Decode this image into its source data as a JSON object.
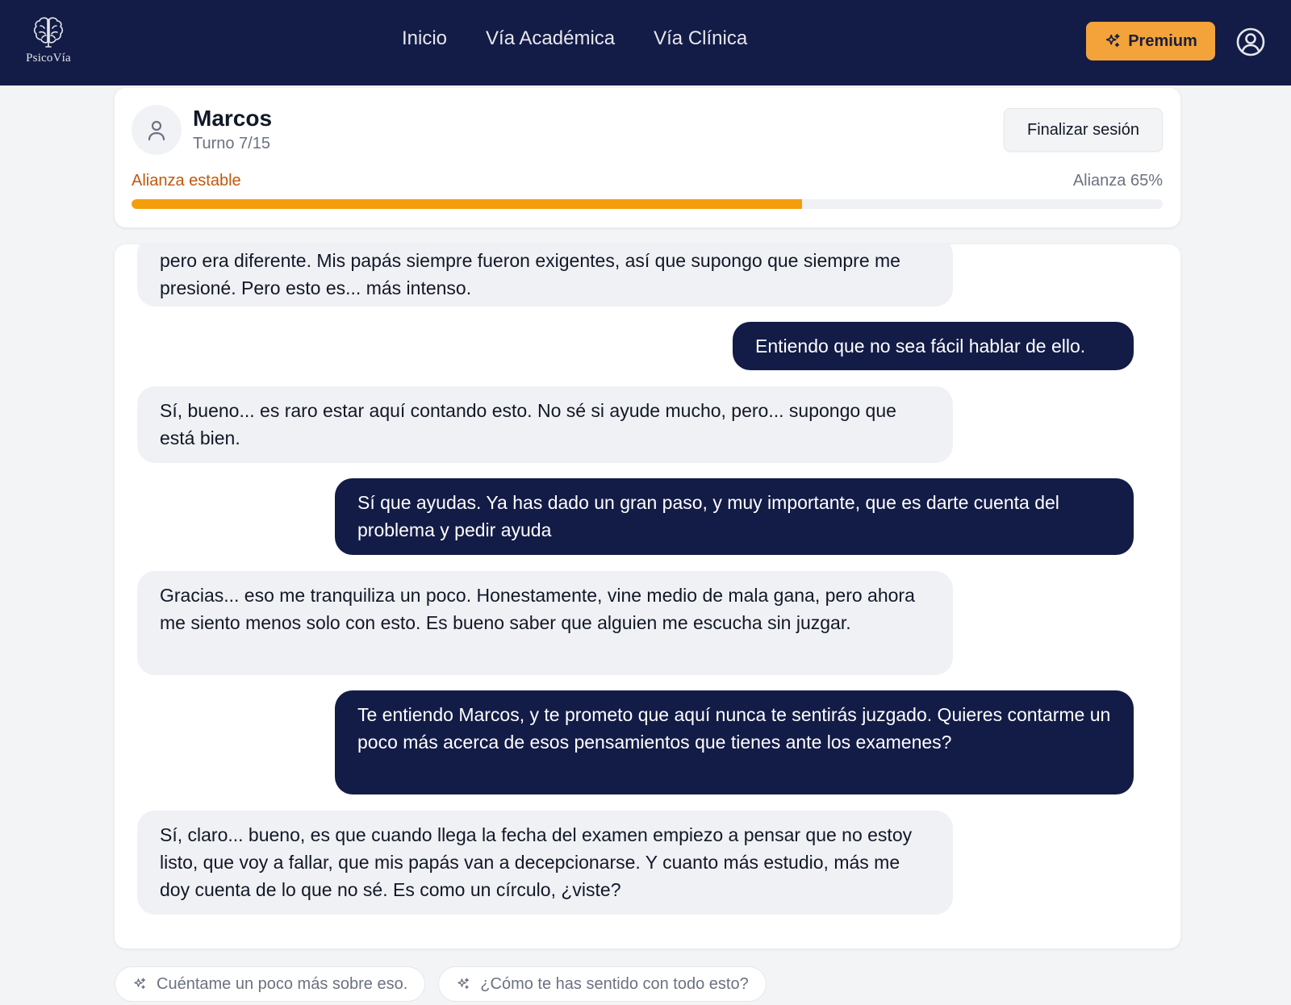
{
  "brand": {
    "name": "PsicoVía",
    "logo_icon": "brain-icon"
  },
  "nav": {
    "items": [
      {
        "label": "Inicio"
      },
      {
        "label": "Vía Académica"
      },
      {
        "label": "Vía Clínica"
      }
    ]
  },
  "header": {
    "premium_label": "Premium",
    "premium_icon": "sparkles-icon",
    "profile_icon": "user-circle-icon",
    "premium_color": "#f3a33a",
    "bar_color": "#131c47"
  },
  "session": {
    "patient_name": "Marcos",
    "turn": "Turno 7/15",
    "end_label": "Finalizar sesión",
    "alliance_status": "Alianza estable",
    "alliance_label": "Alianza 65%",
    "alliance_value": 0.65,
    "alliance_color": "#f59e0b"
  },
  "messages": [
    {
      "role": "patient",
      "text": "pero era diferente. Mis papás siempre fueron exigentes, así que supongo que siempre me presioné. Pero esto es... más intenso."
    },
    {
      "role": "therapist",
      "text": "Entiendo que no sea fácil hablar de ello."
    },
    {
      "role": "patient",
      "text": "Sí, bueno... es raro estar aquí contando esto. No sé si ayude mucho, pero... supongo que está bien."
    },
    {
      "role": "therapist",
      "text": "Sí que ayudas. Ya has dado un gran paso, y muy importante, que es darte cuenta del problema y pedir ayuda"
    },
    {
      "role": "patient",
      "text": "Gracias... eso me tranquiliza un poco. Honestamente, vine medio de mala gana, pero ahora me siento menos solo con esto. Es bueno saber que alguien me escucha sin juzgar."
    },
    {
      "role": "therapist",
      "text": "Te entiendo Marcos, y te prometo que aquí nunca te sentirás juzgado. Quieres contarme un poco más acerca de esos pensamientos que tienes ante los examenes?"
    },
    {
      "role": "patient",
      "text": "Sí, claro... bueno, es que cuando llega la fecha del examen empiezo a pensar que no estoy listo, que voy a fallar, que mis papás van a decepcionarse. Y cuanto más estudio, más me doy cuenta de lo que no sé. Es como un círculo, ¿viste?"
    }
  ],
  "suggestions": [
    {
      "text": "Cuéntame un poco más sobre eso.",
      "icon": "sparkles-icon"
    },
    {
      "text": "¿Cómo te has sentido con todo esto?",
      "icon": "sparkles-icon"
    }
  ]
}
